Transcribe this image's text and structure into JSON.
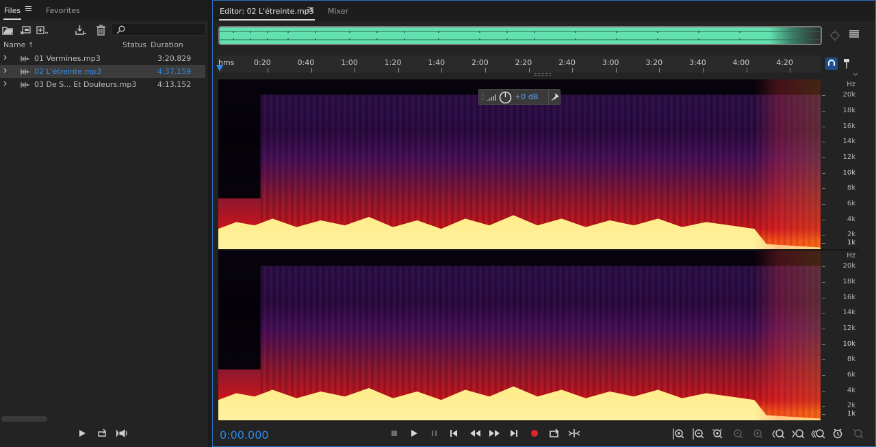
{
  "files_panel": {
    "tabs": [
      {
        "label": "Files",
        "active": true
      },
      {
        "label": "Favorites",
        "active": false
      }
    ],
    "columns": {
      "name": "Name",
      "status": "Status",
      "duration": "Duration"
    },
    "sort_arrow": "↑",
    "files": [
      {
        "name": "01 Vermines.mp3",
        "duration": "3:20.829",
        "selected": false
      },
      {
        "name": "02 L'étreinte.mp3",
        "duration": "4:37.159",
        "selected": true
      },
      {
        "name": "03 De S... Et Douleurs.mp3",
        "duration": "4:13.152",
        "selected": false
      }
    ],
    "toolbar_icons": [
      "open-folder-icon",
      "import-icon",
      "new-file-icon",
      "insert-icon",
      "trash-icon",
      "search-icon"
    ]
  },
  "editor": {
    "tabs": [
      {
        "label": "Editor: 02 L'étreinte.mp3",
        "active": true
      },
      {
        "label": "Mixer",
        "active": false
      }
    ],
    "timeline": {
      "unit": "hms",
      "ticks": [
        "0:20",
        "0:40",
        "1:00",
        "1:20",
        "1:40",
        "2:00",
        "2:20",
        "2:40",
        "3:00",
        "3:20",
        "3:40",
        "4:00",
        "4:20"
      ]
    },
    "freq_axis": {
      "unit": "Hz",
      "labels": [
        "20k",
        "18k",
        "16k",
        "14k",
        "12k",
        "10k",
        "8k",
        "6k",
        "4k",
        "2k",
        "1k"
      ]
    },
    "hud": {
      "gain": "+0 dB"
    },
    "current_time": "0:00.000",
    "colors": {
      "accent": "#2d8ceb",
      "overview_wave": "#62e0b0",
      "record": "#e0262b",
      "spectro_low": "#2b0a3d",
      "spectro_mid": "#e0171c",
      "spectro_high": "#ffe36a"
    }
  }
}
